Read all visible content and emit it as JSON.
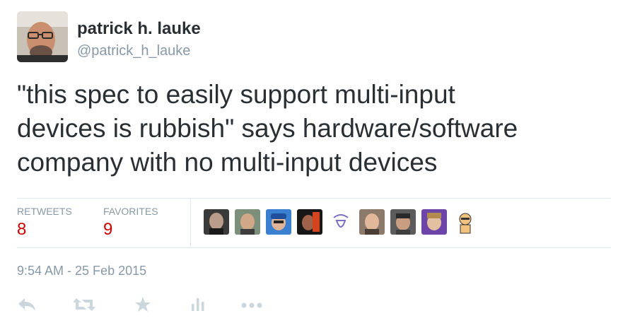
{
  "author": {
    "name": "patrick h. lauke",
    "handle": "@patrick_h_lauke",
    "avatar_icon": "user-avatar"
  },
  "tweet": {
    "lines": [
      "\"this spec to easily support multi-input",
      "devices is rubbish\" says hardware/software",
      "company with no multi-input devices"
    ]
  },
  "stats": {
    "retweets_label": "RETWEETS",
    "retweets_count": "8",
    "favorites_label": "FAVORITES",
    "favorites_count": "9"
  },
  "favoriters": [
    "favoriter-avatar-1",
    "favoriter-avatar-2",
    "favoriter-avatar-3",
    "favoriter-avatar-4",
    "favoriter-avatar-5",
    "favoriter-avatar-6",
    "favoriter-avatar-7",
    "favoriter-avatar-8",
    "favoriter-avatar-9"
  ],
  "timestamp": "9:54 AM - 25 Feb 2015",
  "actions": [
    "reply-icon",
    "retweet-icon",
    "favorite-icon",
    "analytics-icon",
    "more-icon"
  ],
  "colors": {
    "count": "#cc0000",
    "muted": "#8899a6",
    "text": "#292f33",
    "icon": "#ccd6dd",
    "divider": "#e1e8ed"
  }
}
